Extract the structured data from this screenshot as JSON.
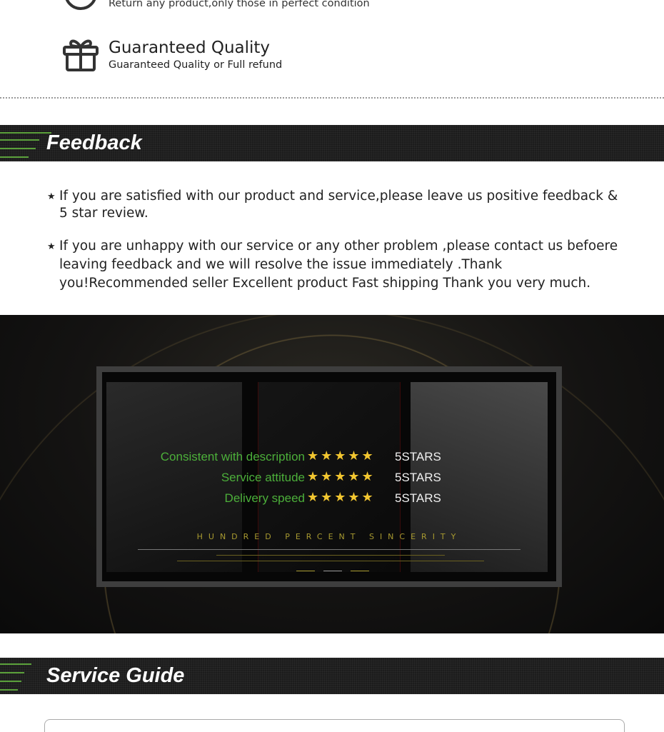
{
  "policies": [
    {
      "icon": "return-icon",
      "subtitle": "Return any product,only those in perfect condition"
    },
    {
      "icon": "gift-icon",
      "title": "Guaranteed Quality",
      "subtitle": "Guaranteed Quality or Full refund"
    }
  ],
  "feedback": {
    "title": "Feedback",
    "items": [
      "If you are satisfied with our product and service,please leave us positive feedback & 5 star review.",
      "If you are unhappy with our service or any other problem ,please contact us befoere leaving feedback and we will resolve the issue immediately .Thank you!Recommended seller Excellent product Fast shipping Thank you very much."
    ]
  },
  "ratings": {
    "rows": [
      {
        "label": "Consistent with description",
        "stars": 5,
        "value": "5STARS"
      },
      {
        "label": "Service attitude",
        "stars": 5,
        "value": "5STARS"
      },
      {
        "label": "Delivery speed",
        "stars": 5,
        "value": "5STARS"
      }
    ],
    "tagline": "HUNDRED PERCENT SINCERITY",
    "colors": {
      "label": "#4caf3a",
      "star": "#f2c630",
      "tagline": "#a89a30"
    }
  },
  "service_guide": {
    "title": "Service Guide"
  },
  "colors": {
    "banner_bg": "#1c1c1c",
    "banner_accent": "#5aa03a"
  }
}
